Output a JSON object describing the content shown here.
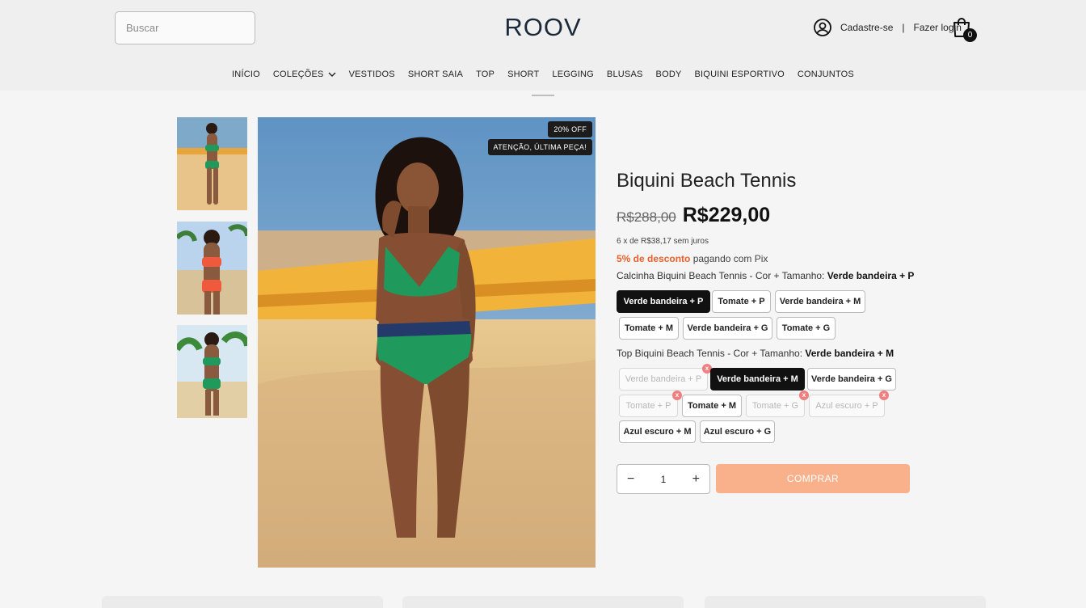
{
  "header": {
    "search_placeholder": "Buscar",
    "logo": "ROOV",
    "signup": "Cadastre-se",
    "separator": "|",
    "login": "Fazer login",
    "cart_count": "0"
  },
  "nav": [
    {
      "label": "INÍCIO"
    },
    {
      "label": "COLEÇÕES",
      "dropdown": true
    },
    {
      "label": "VESTIDOS"
    },
    {
      "label": "SHORT SAIA"
    },
    {
      "label": "TOP"
    },
    {
      "label": "SHORT"
    },
    {
      "label": "LEGGING"
    },
    {
      "label": "BLUSAS"
    },
    {
      "label": "BODY"
    },
    {
      "label": "BIQUINI ESPORTIVO"
    },
    {
      "label": "CONJUNTOS"
    }
  ],
  "image_tags": {
    "discount": "20% OFF",
    "last_piece": "ATENÇÃO, ÚLTIMA PEÇA!"
  },
  "product": {
    "title": "Biquini Beach Tennis",
    "old_price": "R$288,00",
    "price": "R$229,00",
    "installments": "6 x de R$38,17 sem juros",
    "pix_discount": "5% de desconto",
    "pix_text": "pagando com Pix"
  },
  "variant1": {
    "label": "Calcinha Biquini Beach Tennis - Cor + Tamanho:",
    "selected": "Verde bandeira + P",
    "options": [
      {
        "label": "Verde bandeira + P",
        "state": "selected"
      },
      {
        "label": "Tomate + P",
        "state": "available"
      },
      {
        "label": "Verde bandeira + M",
        "state": "available"
      },
      {
        "label": "Tomate + M",
        "state": "available"
      },
      {
        "label": "Verde bandeira + G",
        "state": "available"
      },
      {
        "label": "Tomate + G",
        "state": "available"
      }
    ]
  },
  "variant2": {
    "label": "Top Biquini Beach Tennis - Cor + Tamanho:",
    "selected": "Verde bandeira + M",
    "options": [
      {
        "label": "Verde bandeira + P",
        "state": "unavailable"
      },
      {
        "label": "Verde bandeira + M",
        "state": "selected"
      },
      {
        "label": "Verde bandeira + G",
        "state": "available"
      },
      {
        "label": "Tomate + P",
        "state": "unavailable"
      },
      {
        "label": "Tomate + M",
        "state": "available"
      },
      {
        "label": "Tomate + G",
        "state": "unavailable"
      },
      {
        "label": "Azul escuro + P",
        "state": "unavailable"
      },
      {
        "label": "Azul escuro + M",
        "state": "available"
      },
      {
        "label": "Azul escuro + G",
        "state": "available"
      }
    ],
    "unavailable_mark": "x"
  },
  "purchase": {
    "quantity": "1",
    "minus": "−",
    "plus": "+",
    "buy_label": "COMPRAR"
  },
  "colors": {
    "accent": "#f8b18a",
    "discount_text": "#e8612c",
    "selected_option": "#111111",
    "logo": "#1b2a3a"
  },
  "icons": {
    "search": "search-icon",
    "user": "user-circle-icon",
    "cart": "shopping-bag-icon",
    "chevron": "chevron-down-icon"
  }
}
